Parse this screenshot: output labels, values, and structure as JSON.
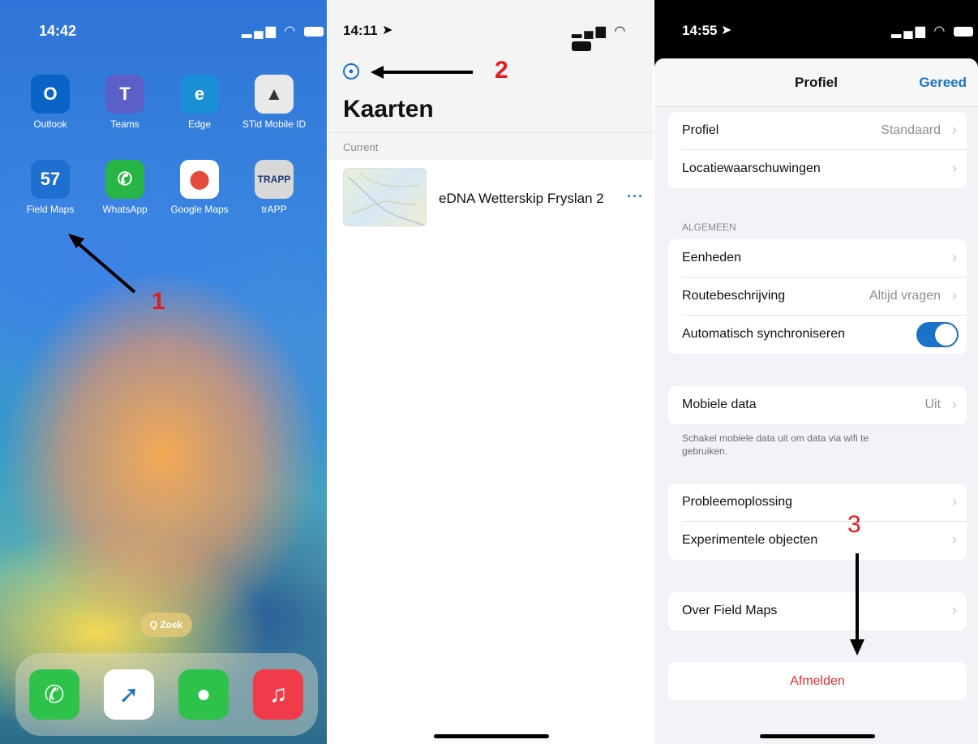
{
  "panel1": {
    "time": "14:42",
    "status_icons": "signal wifi battery",
    "apps_row1": [
      {
        "label": "Outlook",
        "icon": "outlook-icon",
        "color": "#0a64c8",
        "glyph": "O"
      },
      {
        "label": "Teams",
        "icon": "teams-icon",
        "color": "#5b5fc7",
        "glyph": "T"
      },
      {
        "label": "Edge",
        "icon": "edge-icon",
        "color": "#1a8fd8",
        "glyph": "e"
      },
      {
        "label": "STid Mobile ID",
        "icon": "stid-icon",
        "color": "#e9e9e9",
        "glyph": "▲"
      }
    ],
    "apps_row2": [
      {
        "label": "Field Maps",
        "icon": "field-maps-icon",
        "color": "#1e6fd0",
        "glyph": "57"
      },
      {
        "label": "WhatsApp",
        "icon": "whatsapp-icon",
        "color": "#29b446",
        "glyph": "✆"
      },
      {
        "label": "Google Maps",
        "icon": "google-maps-icon",
        "color": "#ffffff",
        "glyph": "⬤"
      },
      {
        "label": "trAPP",
        "icon": "trapp-icon",
        "color": "#d8d8d8",
        "glyph": "TRAPP"
      }
    ],
    "search_label": "Q Zoek",
    "dock": [
      {
        "icon": "phone-icon",
        "color": "#2fc24a",
        "glyph": "✆"
      },
      {
        "icon": "safari-icon",
        "color": "#ffffff",
        "glyph": "➚"
      },
      {
        "icon": "messages-icon",
        "color": "#2fc24a",
        "glyph": "●"
      },
      {
        "icon": "music-icon",
        "color": "#f23b4a",
        "glyph": "♫"
      }
    ],
    "step_label": "1"
  },
  "panel2": {
    "time": "14:11",
    "step_label": "2",
    "title": "Kaarten",
    "section": "Current",
    "map_name": "eDNA Wetterskip Fryslan 2",
    "more": "···"
  },
  "panel3": {
    "time": "14:55",
    "sheet_title": "Profiel",
    "done": "Gereed",
    "group1": [
      {
        "title": "Profiel",
        "value": "Standaard",
        "chevron": "›"
      },
      {
        "title": "Locatiewaarschuwingen",
        "value": "",
        "chevron": "›"
      }
    ],
    "section_general": "ALGEMEEN",
    "group2": [
      {
        "title": "Eenheden",
        "value": "",
        "chevron": "›"
      },
      {
        "title": "Routebeschrijving",
        "value": "Altijd vragen",
        "chevron": "›"
      },
      {
        "title": "Automatisch synchroniseren",
        "toggle": true
      }
    ],
    "group3": [
      {
        "title": "Mobiele data",
        "value": "Uit",
        "chevron": "›"
      }
    ],
    "mobile_note": "Schakel mobiele data uit om data via wifi te gebruiken.",
    "group4": [
      {
        "title": "Probleemoplossing",
        "value": "",
        "chevron": "›"
      },
      {
        "title": "Experimentele objecten",
        "value": "",
        "chevron": "›"
      }
    ],
    "group5": [
      {
        "title": "Over Field Maps",
        "value": "",
        "chevron": "›"
      }
    ],
    "signout": "Afmelden",
    "step_label": "3"
  },
  "colors": {
    "accent": "#1a73c8",
    "annotation_red": "#e31b1b",
    "signout_red": "#e0312c"
  }
}
